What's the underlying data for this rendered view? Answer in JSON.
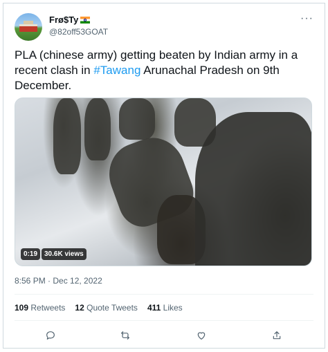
{
  "author": {
    "display_name": "Frø$Ty",
    "handle": "@82off53GOAT",
    "flag_icon": "india-flag-icon"
  },
  "tweet": {
    "text_before": "PLA (chinese army) getting beaten by Indian army in a recent clash in ",
    "hashtag": "#Tawang",
    "text_after": " Arunachal Pradesh on 9th December."
  },
  "media": {
    "duration": "0:19",
    "views": "30.6K views"
  },
  "timestamp": "8:56 PM · Dec 12, 2022",
  "stats": {
    "retweets_count": "109",
    "retweets_label": "Retweets",
    "quotes_count": "12",
    "quotes_label": "Quote Tweets",
    "likes_count": "411",
    "likes_label": "Likes"
  },
  "colors": {
    "link": "#1d9bf0",
    "secondary_text": "#536471",
    "border": "#cfd9de"
  }
}
